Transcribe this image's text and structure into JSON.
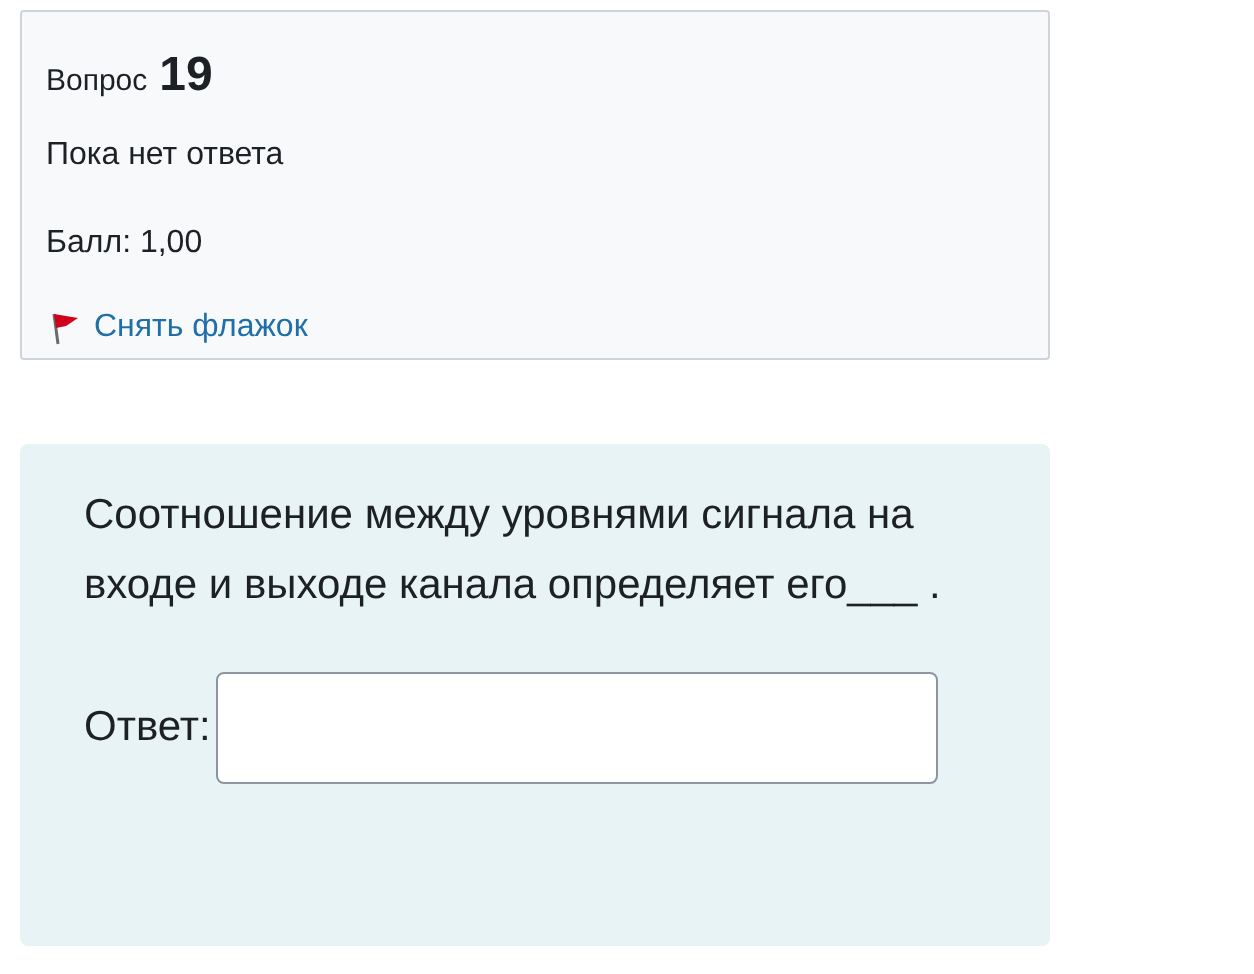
{
  "info": {
    "label": "Вопрос",
    "number": "19",
    "status": "Пока нет ответа",
    "grade": "Балл: 1,00",
    "flag": {
      "label": "Снять флажок",
      "flagged": true
    }
  },
  "question": {
    "text": "Соотношение между уровнями сигнала на входе и выходе канала определяет его___ .",
    "answer_label": "Ответ:"
  }
}
